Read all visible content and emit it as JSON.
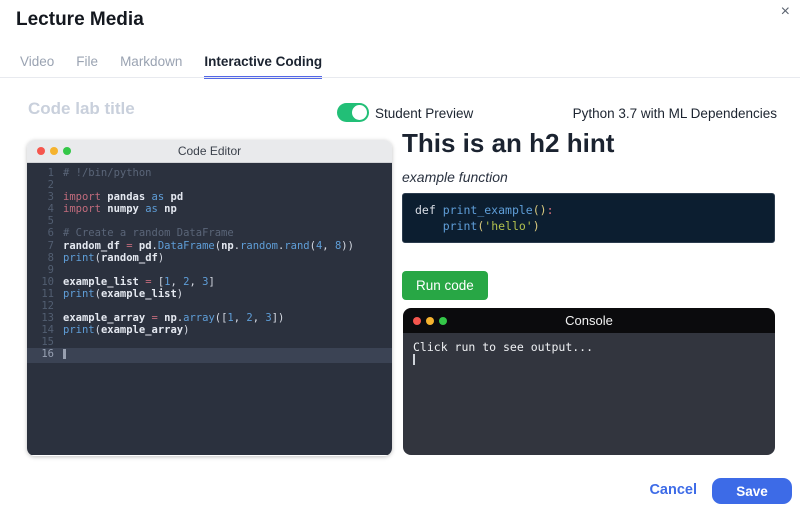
{
  "modal": {
    "title": "Lecture Media",
    "close_icon": "×"
  },
  "tabs": [
    {
      "label": "Video",
      "active": false
    },
    {
      "label": "File",
      "active": false
    },
    {
      "label": "Markdown",
      "active": false
    },
    {
      "label": "Interactive Coding",
      "active": true
    }
  ],
  "toolbar": {
    "title_placeholder": "Code lab title",
    "title_value": "",
    "student_preview_label": "Student Preview",
    "student_preview_on": true,
    "runtime_label": "Python 3.7 with ML Dependencies"
  },
  "editor": {
    "window_title": "Code Editor",
    "traffic_lights": [
      "red",
      "yellow",
      "green"
    ],
    "active_line": 16,
    "lines": [
      {
        "n": 1,
        "tokens": [
          [
            "# !/bin/python",
            "com"
          ]
        ]
      },
      {
        "n": 2,
        "tokens": []
      },
      {
        "n": 3,
        "tokens": [
          [
            "import ",
            "kw"
          ],
          [
            "pandas ",
            "id"
          ],
          [
            "as ",
            "as"
          ],
          [
            "pd",
            "id"
          ]
        ]
      },
      {
        "n": 4,
        "tokens": [
          [
            "import ",
            "kw"
          ],
          [
            "numpy ",
            "id"
          ],
          [
            "as ",
            "as"
          ],
          [
            "np",
            "id"
          ]
        ]
      },
      {
        "n": 5,
        "tokens": []
      },
      {
        "n": 6,
        "tokens": [
          [
            "# Create a random DataFrame",
            "com"
          ]
        ]
      },
      {
        "n": 7,
        "tokens": [
          [
            "random_df ",
            "id"
          ],
          [
            "= ",
            "kw"
          ],
          [
            "pd",
            "id"
          ],
          [
            ".",
            "pu"
          ],
          [
            "DataFrame",
            "fn"
          ],
          [
            "(",
            "pu"
          ],
          [
            "np",
            "id"
          ],
          [
            ".",
            "pu"
          ],
          [
            "random",
            "fn"
          ],
          [
            ".",
            "pu"
          ],
          [
            "rand",
            "fn"
          ],
          [
            "(",
            "pu"
          ],
          [
            "4",
            "num"
          ],
          [
            ", ",
            "pu"
          ],
          [
            "8",
            "num"
          ],
          [
            "))",
            "pu"
          ]
        ]
      },
      {
        "n": 8,
        "tokens": [
          [
            "print",
            "fn"
          ],
          [
            "(",
            "pu"
          ],
          [
            "random_df",
            "id"
          ],
          [
            ")",
            "pu"
          ]
        ]
      },
      {
        "n": 9,
        "tokens": []
      },
      {
        "n": 10,
        "tokens": [
          [
            "example_list ",
            "id"
          ],
          [
            "= ",
            "kw"
          ],
          [
            "[",
            "pu"
          ],
          [
            "1",
            "num"
          ],
          [
            ", ",
            "pu"
          ],
          [
            "2",
            "num"
          ],
          [
            ", ",
            "pu"
          ],
          [
            "3",
            "num"
          ],
          [
            "]",
            "pu"
          ]
        ]
      },
      {
        "n": 11,
        "tokens": [
          [
            "print",
            "fn"
          ],
          [
            "(",
            "pu"
          ],
          [
            "example_list",
            "id"
          ],
          [
            ")",
            "pu"
          ]
        ]
      },
      {
        "n": 12,
        "tokens": []
      },
      {
        "n": 13,
        "tokens": [
          [
            "example_array ",
            "id"
          ],
          [
            "= ",
            "kw"
          ],
          [
            "np",
            "id"
          ],
          [
            ".",
            "pu"
          ],
          [
            "array",
            "fn"
          ],
          [
            "([",
            "pu"
          ],
          [
            "1",
            "num"
          ],
          [
            ", ",
            "pu"
          ],
          [
            "2",
            "num"
          ],
          [
            ", ",
            "pu"
          ],
          [
            "3",
            "num"
          ],
          [
            "])",
            "pu"
          ]
        ]
      },
      {
        "n": 14,
        "tokens": [
          [
            "print",
            "fn"
          ],
          [
            "(",
            "pu"
          ],
          [
            "example_array",
            "id"
          ],
          [
            ")",
            "pu"
          ]
        ]
      },
      {
        "n": 15,
        "tokens": []
      },
      {
        "n": 16,
        "tokens": [],
        "cursor": true
      }
    ]
  },
  "preview": {
    "heading": "This is an h2 hint",
    "subheading": "example function",
    "snippet_lines": [
      [
        [
          "def ",
          "def"
        ],
        [
          "print_example",
          "fn"
        ],
        [
          "()",
          "par"
        ],
        [
          ":",
          "col"
        ]
      ],
      [
        [
          "    ",
          "pu"
        ],
        [
          "print",
          "fn"
        ],
        [
          "(",
          "par"
        ],
        [
          "'hello'",
          "str"
        ],
        [
          ")",
          "par"
        ]
      ]
    ],
    "run_button_label": "Run code"
  },
  "console": {
    "window_title": "Console",
    "traffic_lights": [
      "red",
      "yellow",
      "green"
    ],
    "output": "Click run to see output..."
  },
  "footer": {
    "cancel_label": "Cancel",
    "save_label": "Save"
  },
  "colors": {
    "tab_underline": "#5468e7",
    "toggle_green": "#22bf77",
    "run_green": "#28a745",
    "accent_blue": "#3d6be7",
    "editor_bg": "#2b313e",
    "editor_active_line": "#3b4354",
    "snippet_bg": "#0c1e30",
    "console_titlebar": "#0b0b0d",
    "console_bg": "#32353e"
  }
}
